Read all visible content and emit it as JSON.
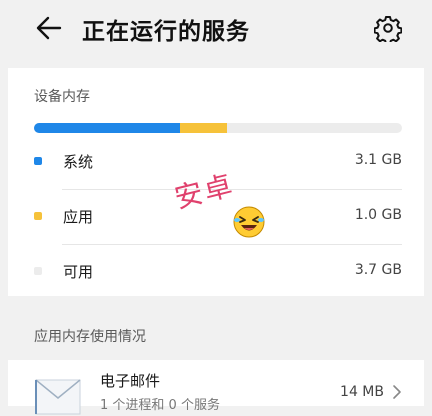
{
  "header": {
    "title": "正在运行的服务"
  },
  "memory": {
    "section_title": "设备内存",
    "usage_bar": {
      "system_fraction": 0.3975,
      "apps_fraction": 0.1282,
      "system_color": "#1f87e8",
      "apps_color": "#f6c23a",
      "free_color": "#ececec"
    },
    "rows": [
      {
        "label": "系统",
        "value": "3.1 GB",
        "color": "#1f87e8"
      },
      {
        "label": "应用",
        "value": "1.0 GB",
        "color": "#f6c23a"
      },
      {
        "label": "可用",
        "value": "3.7 GB",
        "color": "#ececec"
      }
    ]
  },
  "app_usage": {
    "section_title": "应用内存使用情况",
    "apps": [
      {
        "name": "电子邮件",
        "subtitle": "1 个进程和 0 个服务",
        "size": "14 MB",
        "icon": "mail-icon"
      }
    ]
  },
  "overlay": {
    "watermark": "安卓",
    "emoji": "laughing-emoji-icon"
  },
  "icons": {
    "back": "back-arrow-icon",
    "settings": "gear-icon",
    "more": "chevron-right-icon"
  }
}
